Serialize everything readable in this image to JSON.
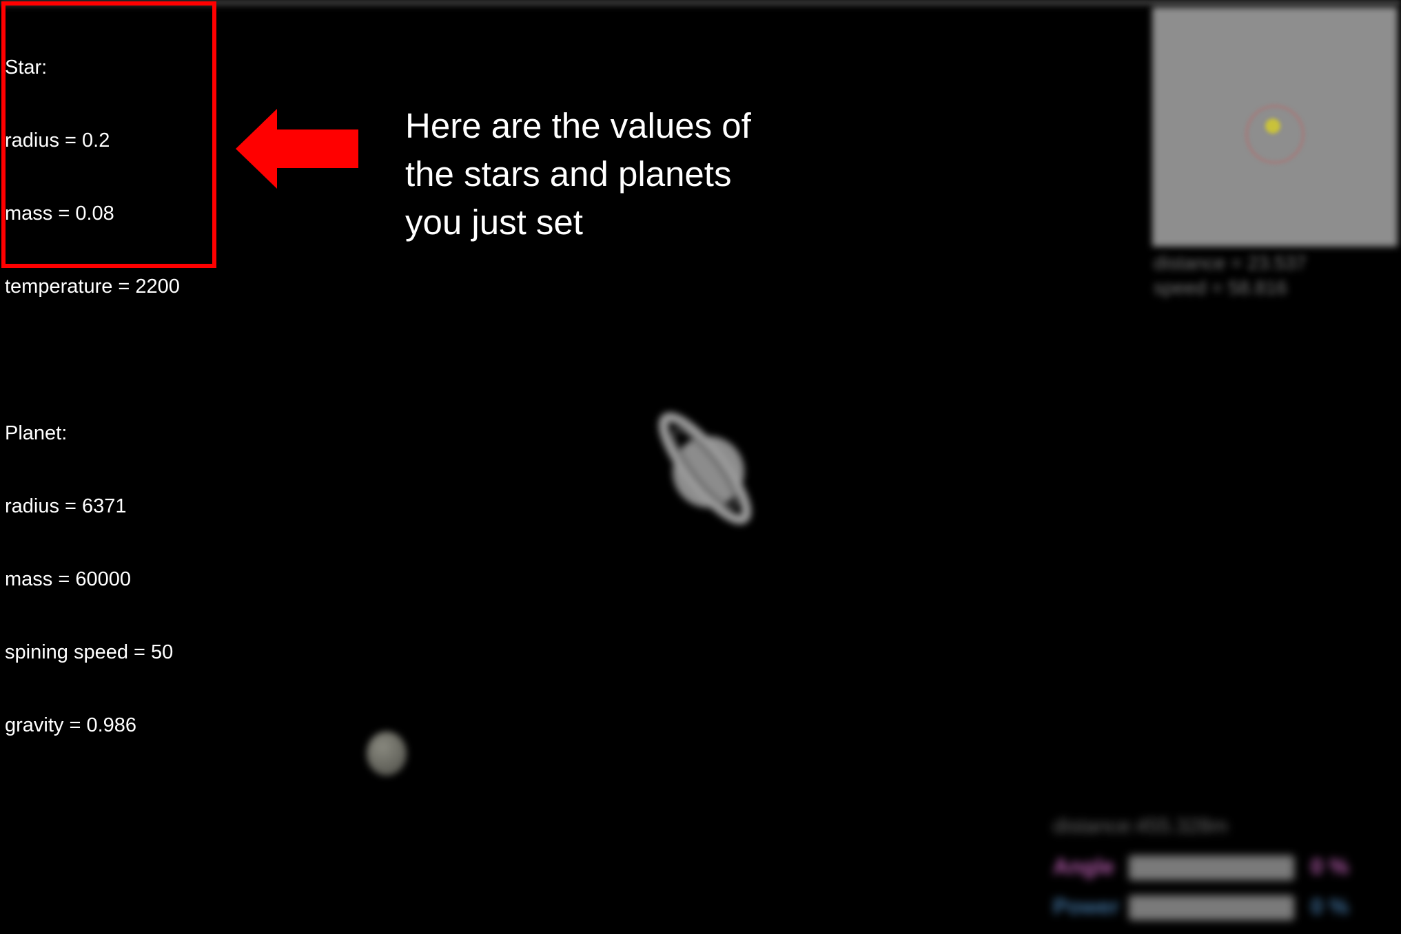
{
  "info_panel": {
    "star_heading": "Star:",
    "star_radius": "radius = 0.2",
    "star_mass": "mass = 0.08",
    "star_temperature": "temperature = 2200",
    "planet_heading": "Planet:",
    "planet_radius": "radius = 6371",
    "planet_mass": "mass = 60000",
    "planet_spin": "spining speed = 50",
    "planet_gravity": "gravity = 0.986"
  },
  "annotation": {
    "line1": "Here are the values of",
    "line2": "the stars and planets",
    "line3": "you just set"
  },
  "minimap": {
    "distance_text": "distance = 23.537",
    "speed_text": "speed = 58.816"
  },
  "hud": {
    "distance_text": "distance:455.328m",
    "angle_label": "Angle",
    "angle_value": 0,
    "angle_percent": "0 %",
    "power_label": "Power",
    "power_value": 0,
    "power_percent": "0 %"
  },
  "colors": {
    "highlight": "#ff0000",
    "angle_label": "#b05aa8",
    "power_label": "#3f6f9a"
  }
}
